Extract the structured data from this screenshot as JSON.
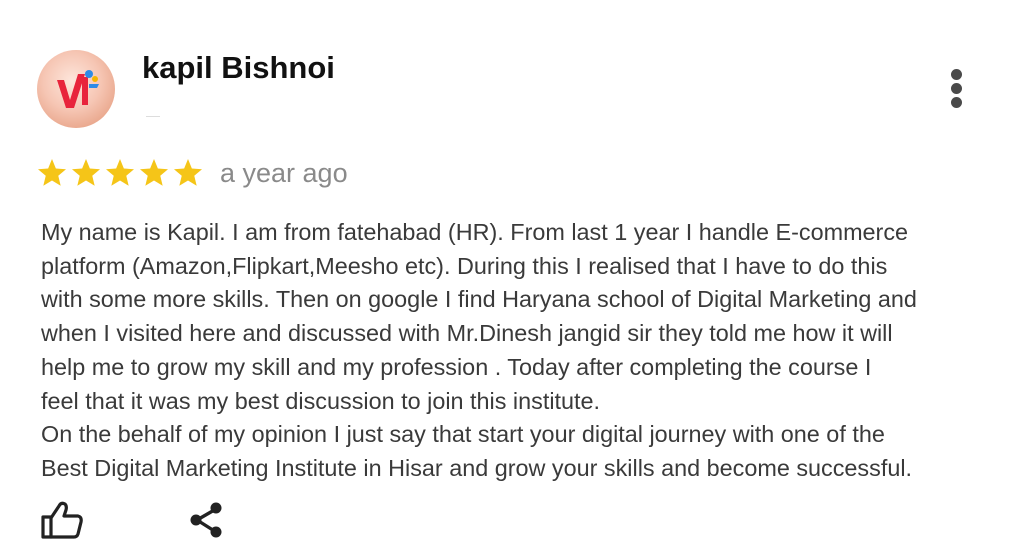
{
  "review": {
    "reviewer_name": "kapil Bishnoi",
    "avatar_icon": "user-avatar-logo",
    "rating": 5,
    "rating_max": 5,
    "star_color": "#f5c518",
    "date": "a year ago",
    "paragraphs": [
      "My name is Kapil. I am from fatehabad (HR). From last 1 year I handle E-commerce",
      "platform (Amazon,Flipkart,Meesho etc). During this I realised that I have to do this",
      "with some more skills. Then on google I find Haryana school of Digital Marketing and",
      "when I visited here and discussed with Mr.Dinesh jangid sir they told me how it will",
      "help me to grow my skill and my profession . Today after completing the course I",
      "feel that it was my best discussion to join this institute.",
      "On the behalf of my opinion I just say that start your digital journey with one of the",
      "Best Digital Marketing Institute in Hisar and grow your skills and become successful."
    ]
  },
  "actions": {
    "more_icon": "more-vertical-icon",
    "like_icon": "thumbs-up-icon",
    "share_icon": "share-icon"
  }
}
